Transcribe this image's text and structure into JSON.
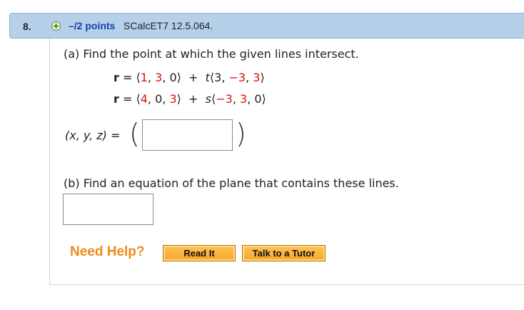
{
  "question": {
    "number": "8.",
    "points": "–/2 points",
    "source": "SCalcET7 12.5.064."
  },
  "part_a": {
    "prompt": "(a) Find the point at which the given lines intersect.",
    "line1": {
      "r": "r",
      "eq": " = ",
      "open": "⟨",
      "v1": "1",
      "c1": ", ",
      "v2": "3",
      "c2": ", ",
      "v3": "0",
      "close": "⟩",
      "plus": "  +  ",
      "param": "t",
      "open2": "⟨",
      "w1": "3",
      "d1": ", ",
      "w2": "−3",
      "d2": ", ",
      "w3": "3",
      "close2": "⟩"
    },
    "line2": {
      "r": "r",
      "eq": " = ",
      "open": "⟨",
      "v1": "4",
      "c1": ", ",
      "v2": "0",
      "c2": ", ",
      "v3": "3",
      "close": "⟩",
      "plus": "  +  ",
      "param": "s",
      "open2": "⟨",
      "w1": "−3",
      "d1": ", ",
      "w2": "3",
      "d2": ", ",
      "w3": "0",
      "close2": "⟩"
    },
    "answer_label": "(x, y, z)  =",
    "answer_value": ""
  },
  "part_b": {
    "prompt": "(b) Find an equation of the plane that contains these lines.",
    "answer_value": ""
  },
  "help": {
    "label": "Need Help?",
    "read_it": "Read It",
    "talk_to_tutor": "Talk to a Tutor"
  },
  "colors": {
    "header_bg": "#b6d0ea",
    "points_blue": "#1a3fa8",
    "value_red": "#d11",
    "help_orange": "#f08a1a",
    "button_orange": "#f5a623"
  }
}
